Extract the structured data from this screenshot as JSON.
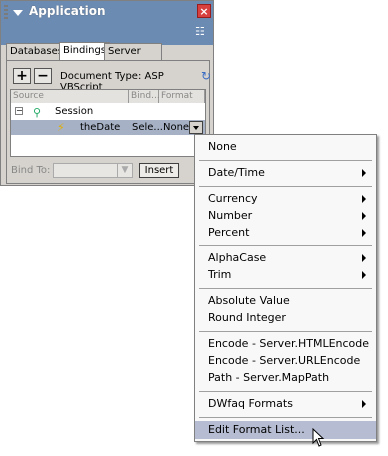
{
  "panel": {
    "title": "Application",
    "tabs": [
      "Databases",
      "Bindings",
      "Server Behaviors"
    ],
    "active_tab": "Bindings",
    "add_label": "+",
    "remove_label": "−",
    "document_type": "Document Type: ASP VBScript",
    "columns": [
      "Source",
      "Bind...",
      "Format"
    ],
    "tree": {
      "session_label": "Session",
      "child_label": "theDate",
      "child_binding": "Sele...",
      "child_format": "None"
    },
    "bind_to_label": "Bind To:",
    "insert_label": "Insert"
  },
  "menu": {
    "items": [
      {
        "label": "None"
      },
      {
        "label": "Date/Time"
      },
      {
        "label": "Currency"
      },
      {
        "label": "Number"
      },
      {
        "label": "Percent"
      },
      {
        "label": "AlphaCase"
      },
      {
        "label": "Trim"
      },
      {
        "label": "Absolute Value"
      },
      {
        "label": "Round Integer"
      },
      {
        "label": "Encode - Server.HTMLEncode"
      },
      {
        "label": "Encode - Server.URLEncode"
      },
      {
        "label": "Path - Server.MapPath"
      },
      {
        "label": "DWfaq Formats"
      },
      {
        "label": "Edit Format List..."
      }
    ]
  },
  "colors": {
    "titlebar": "#6b8bb3",
    "menu_highlight": "#b6bdd2",
    "selected_row": "#a6b1c6"
  }
}
